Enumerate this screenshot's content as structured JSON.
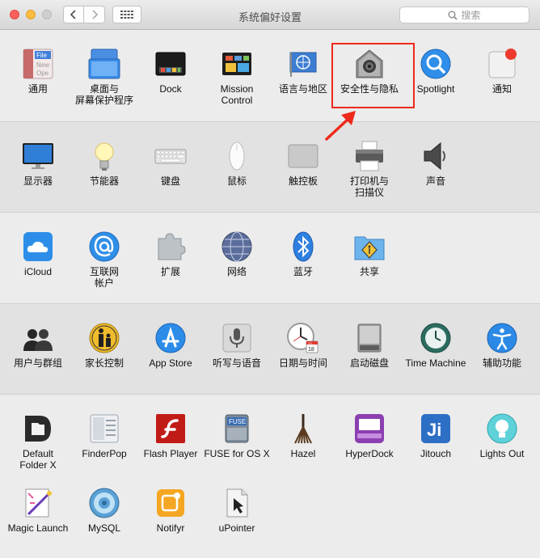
{
  "window": {
    "title": "系统偏好设置",
    "search_placeholder": "搜索"
  },
  "sections": [
    {
      "panes": [
        {
          "label": "通用",
          "icon": "general-icon"
        },
        {
          "label": "桌面与\n屏幕保护程序",
          "icon": "desktop-screensaver-icon"
        },
        {
          "label": "Dock",
          "icon": "dock-icon"
        },
        {
          "label": "Mission\nControl",
          "icon": "mission-control-icon"
        },
        {
          "label": "语言与地区",
          "icon": "language-region-icon"
        },
        {
          "label": "安全性与隐私",
          "icon": "security-privacy-icon"
        },
        {
          "label": "Spotlight",
          "icon": "spotlight-icon"
        },
        {
          "label": "通知",
          "icon": "notifications-icon"
        }
      ]
    },
    {
      "panes": [
        {
          "label": "显示器",
          "icon": "displays-icon"
        },
        {
          "label": "节能器",
          "icon": "energy-saver-icon"
        },
        {
          "label": "键盘",
          "icon": "keyboard-icon"
        },
        {
          "label": "鼠标",
          "icon": "mouse-icon"
        },
        {
          "label": "触控板",
          "icon": "trackpad-icon"
        },
        {
          "label": "打印机与\n扫描仪",
          "icon": "printer-icon"
        },
        {
          "label": "声音",
          "icon": "sound-icon"
        }
      ]
    },
    {
      "panes": [
        {
          "label": "iCloud",
          "icon": "icloud-icon"
        },
        {
          "label": "互联网\n帐户",
          "icon": "internet-accounts-icon"
        },
        {
          "label": "扩展",
          "icon": "extensions-icon"
        },
        {
          "label": "网络",
          "icon": "network-icon"
        },
        {
          "label": "蓝牙",
          "icon": "bluetooth-icon"
        },
        {
          "label": "共享",
          "icon": "sharing-icon"
        }
      ]
    },
    {
      "panes": [
        {
          "label": "用户与群组",
          "icon": "users-groups-icon"
        },
        {
          "label": "家长控制",
          "icon": "parental-controls-icon"
        },
        {
          "label": "App Store",
          "icon": "app-store-icon"
        },
        {
          "label": "听写与语音",
          "icon": "dictation-speech-icon"
        },
        {
          "label": "日期与时间",
          "icon": "date-time-icon"
        },
        {
          "label": "启动磁盘",
          "icon": "startup-disk-icon"
        },
        {
          "label": "Time Machine",
          "icon": "time-machine-icon"
        },
        {
          "label": "辅助功能",
          "icon": "accessibility-icon"
        }
      ]
    },
    {
      "panes": [
        {
          "label": "Default\nFolder X",
          "icon": "default-folder-icon"
        },
        {
          "label": "FinderPop",
          "icon": "finderpop-icon"
        },
        {
          "label": "Flash Player",
          "icon": "flash-player-icon"
        },
        {
          "label": "FUSE for OS X",
          "icon": "fuse-icon"
        },
        {
          "label": "Hazel",
          "icon": "hazel-icon"
        },
        {
          "label": "HyperDock",
          "icon": "hyperdock-icon"
        },
        {
          "label": "Jitouch",
          "icon": "jitouch-icon"
        },
        {
          "label": "Lights Out",
          "icon": "lights-out-icon"
        },
        {
          "label": "Magic Launch",
          "icon": "magic-launch-icon"
        },
        {
          "label": "MySQL",
          "icon": "mysql-icon"
        },
        {
          "label": "Notifyr",
          "icon": "notifyr-icon"
        },
        {
          "label": "uPointer",
          "icon": "upointer-icon"
        }
      ]
    }
  ],
  "icon_texts": {
    "general_file": "File",
    "general_new": "New",
    "general_open": "Ope",
    "fuse": "FUSE",
    "jitouch": "Ji",
    "calendar_month": "JUL",
    "calendar_day": "18"
  },
  "colors": {
    "highlight_box": "#ee2a1b",
    "arrow": "#ee2a1b"
  }
}
